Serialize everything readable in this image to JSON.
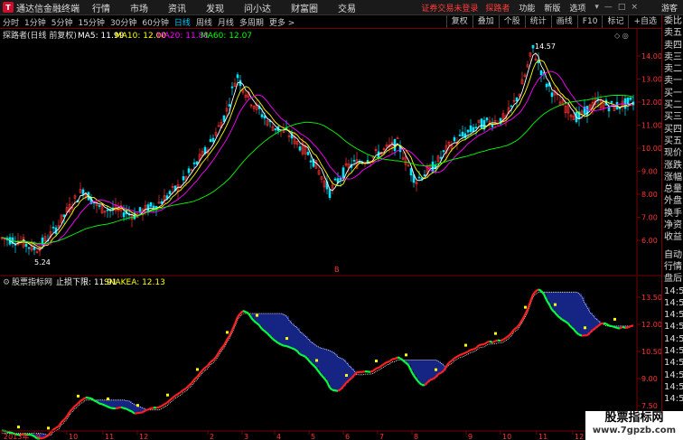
{
  "app": {
    "title": "通达信金融终端",
    "logo_text": "T"
  },
  "menu": [
    "行情",
    "市场",
    "资讯",
    "发现",
    "问小达",
    "财富圈",
    "交易"
  ],
  "login": {
    "status": "证券交易未登录",
    "link": "探路者"
  },
  "utility": [
    "功能",
    "新版",
    "选项"
  ],
  "window_controls": [
    "▾",
    "—",
    "□",
    "×"
  ],
  "guest": "游客",
  "periods": [
    {
      "label": "分时",
      "active": false
    },
    {
      "label": "1分钟",
      "active": false
    },
    {
      "label": "5分钟",
      "active": false
    },
    {
      "label": "15分钟",
      "active": false
    },
    {
      "label": "30分钟",
      "active": false
    },
    {
      "label": "60分钟",
      "active": false
    },
    {
      "label": "日线",
      "active": true
    },
    {
      "label": "周线",
      "active": false
    },
    {
      "label": "月线",
      "active": false
    },
    {
      "label": "多周期",
      "active": false
    },
    {
      "label": "更多 >",
      "active": false
    }
  ],
  "tools": [
    "复权",
    "叠加",
    "个股",
    "统计",
    "画线",
    "F10",
    "标记",
    "+自选"
  ],
  "main_chart": {
    "stock_name": "探路者(日线 前复权)",
    "ma": [
      {
        "label": "MA5: 11.99",
        "color": "#ffffff"
      },
      {
        "label": "MA10: 12.00",
        "color": "#ffff00"
      },
      {
        "label": "MA20: 11.88",
        "color": "#ff00ff"
      },
      {
        "label": "MA60: 12.07",
        "color": "#00ff00"
      }
    ],
    "high_label": "14.57",
    "low_label": "5.24",
    "marker_b": "B",
    "y_ticks": [
      "14.00",
      "13.00",
      "12.00",
      "11.00",
      "10.00",
      "9.00",
      "8.00",
      "7.00",
      "6.00"
    ]
  },
  "indicator": {
    "name": "股票指标网",
    "stop_loss": "止损下限: 11.91",
    "snake": "SNAKEA: 12.13",
    "y_ticks": [
      "13.50",
      "12.00",
      "10.50",
      "9.00",
      "7.50"
    ]
  },
  "x_axis": [
    "2013年",
    "9",
    "10",
    "11",
    "12",
    "2",
    "3",
    "4",
    "5",
    "6",
    "7",
    "8",
    "9",
    "10",
    "11",
    "12"
  ],
  "side_panel": [
    "委比",
    "卖五",
    "卖四",
    "卖三",
    "卖二",
    "卖一",
    "买一",
    "买二",
    "买三",
    "买四",
    "买五",
    "现价",
    "涨跌",
    "涨幅",
    "总量",
    "外盘",
    "换手",
    "净资",
    "收益",
    "",
    "自动",
    "行情",
    "盘后",
    "14:5",
    "14:5",
    "14:5",
    "14:5",
    "14:5",
    "14:5",
    "14:5",
    "14:5",
    "14:5",
    "14:5"
  ],
  "watermark": {
    "line1": "股票指标网",
    "line2": "www.7gpzb.com"
  },
  "colors": {
    "up": "#ff3333",
    "down": "#00e5ff",
    "ma5": "#ffffff",
    "ma10": "#ffff00",
    "ma20": "#ff00ff",
    "ma60": "#00ff00"
  }
}
